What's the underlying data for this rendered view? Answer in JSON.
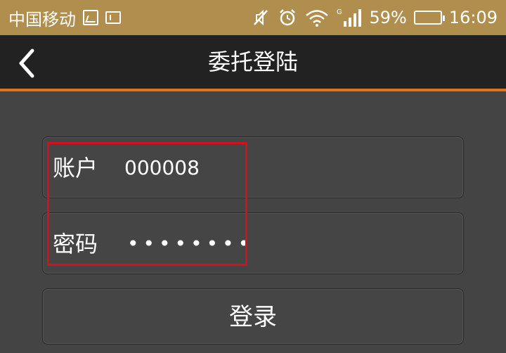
{
  "status_bar": {
    "carrier": "中国移动",
    "network_type": "G",
    "battery_percent": "59%",
    "battery_level": 0.59,
    "time": "16:09",
    "icons": [
      "image-icon",
      "sim-icon",
      "mute-icon",
      "alarm-icon",
      "wifi-icon",
      "signal-icon",
      "battery-icon"
    ]
  },
  "header": {
    "title": "委托登陆",
    "back_icon": "chevron-left-icon"
  },
  "form": {
    "account_label": "账户",
    "account_value": "000008",
    "password_label": "密码",
    "password_value": "••••••••",
    "login_label": "登录"
  },
  "colors": {
    "status_bar": "#b08f4e",
    "header": "#222222",
    "accent": "#e0731b",
    "background": "#444444",
    "highlight": "#d4101a"
  }
}
